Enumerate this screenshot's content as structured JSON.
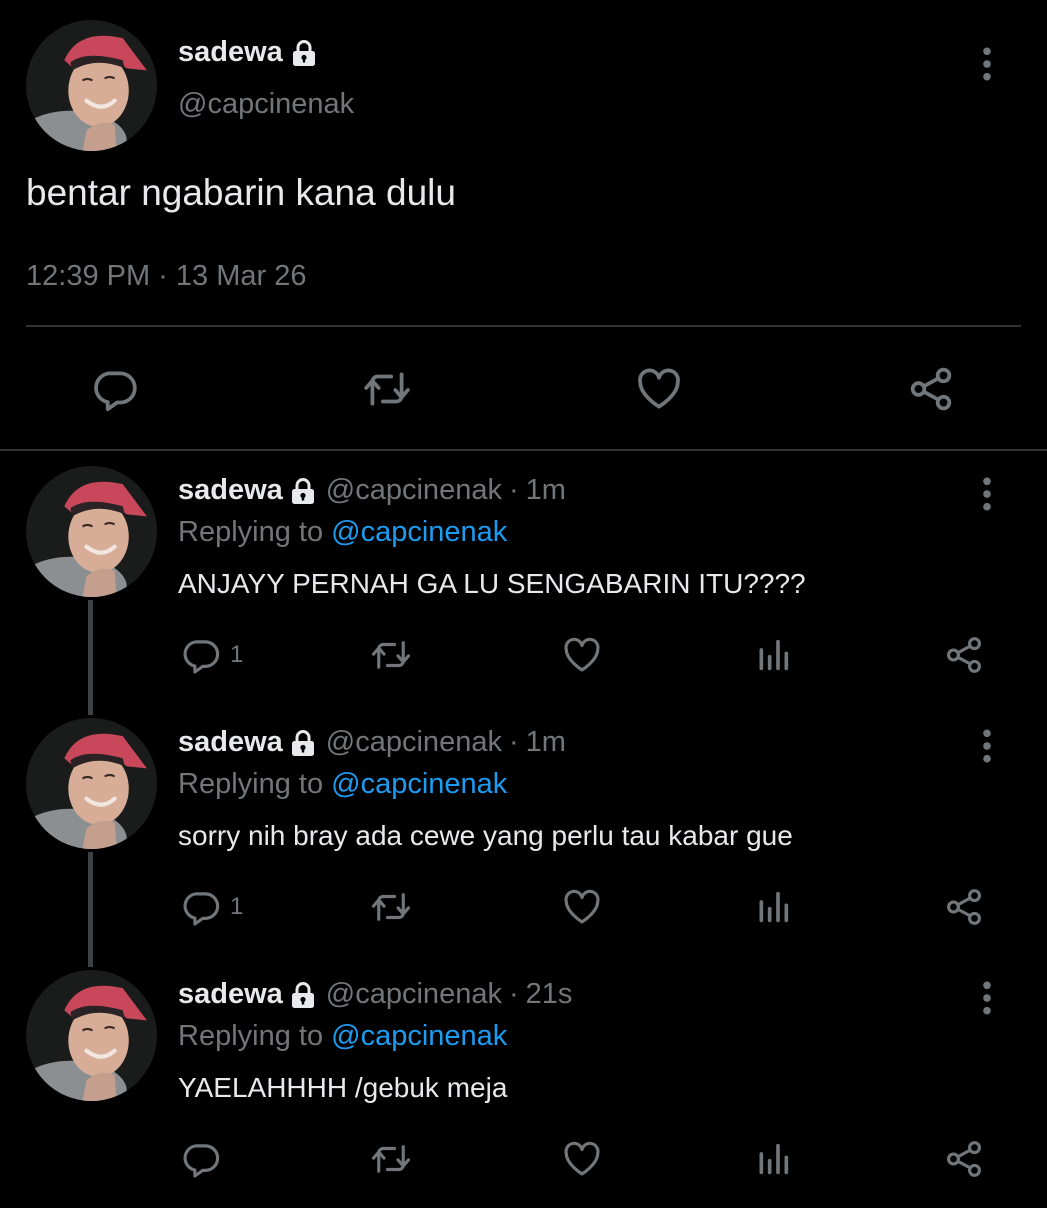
{
  "main_tweet": {
    "display_name": "sadewa",
    "handle": "@capcinenak",
    "text": "bentar ngabarin kana dulu",
    "timestamp": "12:39 PM · 13 Mar 26",
    "icons": [
      "lock-icon",
      "more-icon",
      "reply-icon",
      "retweet-icon",
      "like-icon",
      "share-icon"
    ]
  },
  "replies": [
    {
      "display_name": "sadewa",
      "handle": "@capcinenak",
      "separator": "·",
      "time": "1m",
      "replying_prefix": "Replying to",
      "replying_handle": "@capcinenak",
      "text": "ANJAYY PERNAH GA LU SENGABARIN ITU????",
      "reply_count": "1"
    },
    {
      "display_name": "sadewa",
      "handle": "@capcinenak",
      "separator": "·",
      "time": "1m",
      "replying_prefix": "Replying to",
      "replying_handle": "@capcinenak",
      "text": "sorry nih bray ada cewe yang perlu tau kabar gue",
      "reply_count": "1"
    },
    {
      "display_name": "sadewa",
      "handle": "@capcinenak",
      "separator": "·",
      "time": "21s",
      "replying_prefix": "Replying to",
      "replying_handle": "@capcinenak",
      "text": "YAELAHHHH /gebuk meja",
      "reply_count": ""
    }
  ],
  "colors": {
    "background": "#000000",
    "text": "#e7e9ea",
    "muted": "#71767b",
    "link": "#1d9bf0",
    "divider": "#2f3336"
  }
}
